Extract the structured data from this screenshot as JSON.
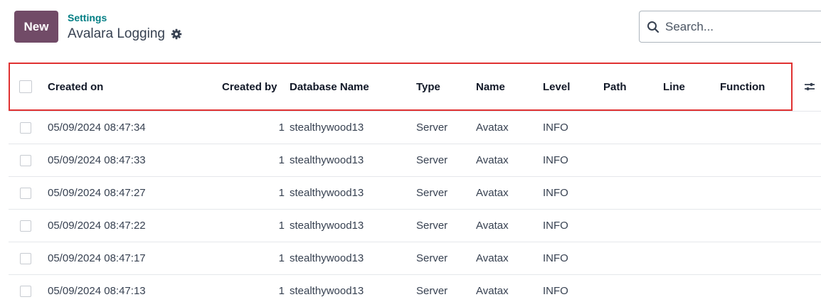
{
  "control_panel": {
    "new_label": "New",
    "breadcrumb": "Settings",
    "title": "Avalara Logging",
    "search_placeholder": "Search..."
  },
  "table": {
    "headers": {
      "created_on": "Created on",
      "created_by": "Created by",
      "database_name": "Database Name",
      "type": "Type",
      "name": "Name",
      "level": "Level",
      "path": "Path",
      "line": "Line",
      "function": "Function"
    },
    "rows": [
      {
        "created_on": "05/09/2024 08:47:34",
        "created_by": "1",
        "database_name": "stealthywood13",
        "type": "Server",
        "name": "Avatax",
        "level": "INFO",
        "path": "",
        "line": "",
        "function": ""
      },
      {
        "created_on": "05/09/2024 08:47:33",
        "created_by": "1",
        "database_name": "stealthywood13",
        "type": "Server",
        "name": "Avatax",
        "level": "INFO",
        "path": "",
        "line": "",
        "function": ""
      },
      {
        "created_on": "05/09/2024 08:47:27",
        "created_by": "1",
        "database_name": "stealthywood13",
        "type": "Server",
        "name": "Avatax",
        "level": "INFO",
        "path": "",
        "line": "",
        "function": ""
      },
      {
        "created_on": "05/09/2024 08:47:22",
        "created_by": "1",
        "database_name": "stealthywood13",
        "type": "Server",
        "name": "Avatax",
        "level": "INFO",
        "path": "",
        "line": "",
        "function": ""
      },
      {
        "created_on": "05/09/2024 08:47:17",
        "created_by": "1",
        "database_name": "stealthywood13",
        "type": "Server",
        "name": "Avatax",
        "level": "INFO",
        "path": "",
        "line": "",
        "function": ""
      },
      {
        "created_on": "05/09/2024 08:47:13",
        "created_by": "1",
        "database_name": "stealthywood13",
        "type": "Server",
        "name": "Avatax",
        "level": "INFO",
        "path": "",
        "line": "",
        "function": ""
      }
    ]
  },
  "colors": {
    "primary": "#714b67",
    "breadcrumb": "#017e84",
    "highlight": "#e03131"
  }
}
